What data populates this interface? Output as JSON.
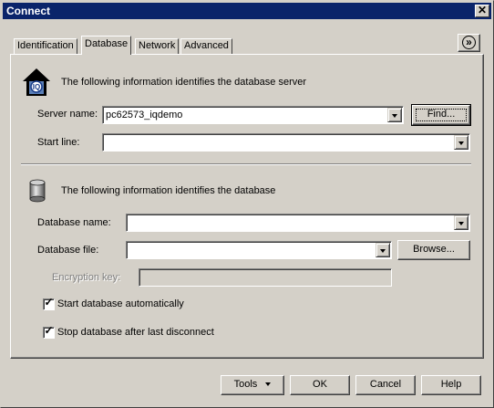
{
  "window": {
    "title": "Connect",
    "close_glyph": "✕"
  },
  "tabs": [
    {
      "label": "Identification",
      "active": false
    },
    {
      "label": "Database",
      "active": true
    },
    {
      "label": "Network",
      "active": false
    },
    {
      "label": "Advanced",
      "active": false
    }
  ],
  "expand_glyph": "»",
  "server_section": {
    "heading": "The following information identifies the database server",
    "icon": "iq-server-house-icon",
    "server_name_label": "Server name:",
    "server_name_value": "pc62573_iqdemo",
    "find_label": "Find...",
    "start_line_label": "Start line:",
    "start_line_value": ""
  },
  "database_section": {
    "heading": "The following information identifies the database",
    "icon": "database-cylinder-icon",
    "database_name_label": "Database name:",
    "database_name_value": "",
    "database_file_label": "Database file:",
    "database_file_value": "",
    "browse_label": "Browse...",
    "encryption_key_label": "Encryption key:",
    "encryption_key_value": ""
  },
  "options": {
    "start_auto_label": "Start database automatically",
    "start_auto_checked": true,
    "stop_after_label": "Stop database after last disconnect",
    "stop_after_checked": true,
    "check_glyph": "✓"
  },
  "footer": {
    "tools_label": "Tools",
    "ok_label": "OK",
    "cancel_label": "Cancel",
    "help_label": "Help"
  }
}
